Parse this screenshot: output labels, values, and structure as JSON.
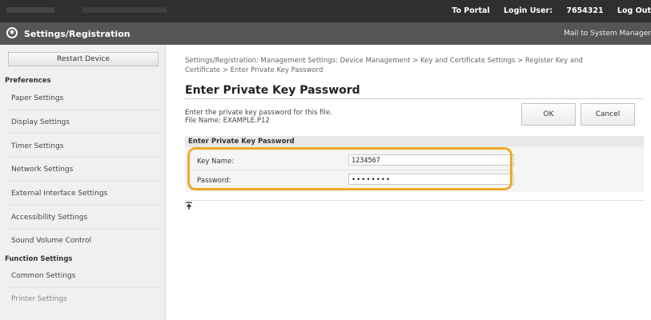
{
  "topbar": {
    "portal_link": "To Portal",
    "login_user_label": "Login User:",
    "login_user_value": "7654321",
    "logout_label": "Log Out"
  },
  "titlebar": {
    "title": "Settings/Registration",
    "mail_link": "Mail to System Manager"
  },
  "sidebar": {
    "restart_button": "Restart Device",
    "preferences_heading": "Preferences",
    "preferences_items": [
      "Paper Settings",
      "Display Settings",
      "Timer Settings",
      "Network Settings",
      "External Interface Settings",
      "Accessibility Settings",
      "Sound Volume Control"
    ],
    "function_heading": "Function Settings",
    "function_items": [
      "Common Settings",
      "Printer Settings"
    ]
  },
  "main": {
    "breadcrumb_line1": "Settings/Registration: Management Settings: Device Management > Key and Certificate Settings > Register Key and",
    "breadcrumb_line2": "Certificate > Enter Private Key Password",
    "page_title": "Enter Private Key Password",
    "description_line1": "Enter the private key password for this file.",
    "description_line2": "File Name: EXAMPLE.P12",
    "ok_button": "OK",
    "cancel_button": "Cancel",
    "form_heading": "Enter Private Key Password",
    "key_name_label": "Key Name:",
    "key_name_value": "1234567",
    "password_label": "Password:",
    "password_value": "••••••••"
  },
  "colors": {
    "highlight": "#f0a82a",
    "topbar": "#2f2f2f",
    "titlebar": "#555555"
  }
}
